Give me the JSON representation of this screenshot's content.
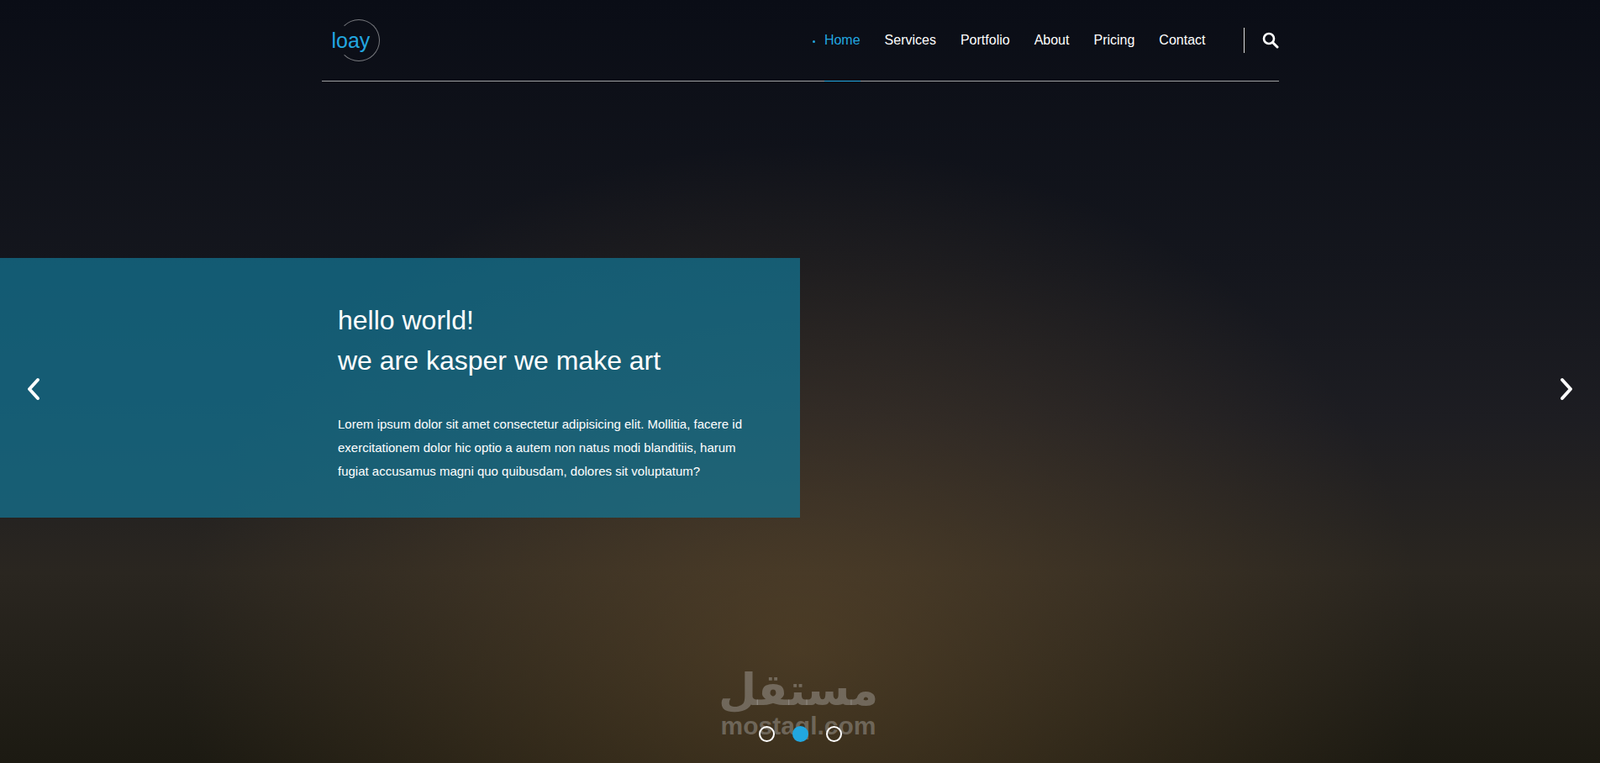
{
  "header": {
    "logo": "loay",
    "nav": [
      {
        "label": "Home",
        "selected": true
      },
      {
        "label": "Services",
        "selected": false
      },
      {
        "label": "Portfolio",
        "selected": false
      },
      {
        "label": "About",
        "selected": false
      },
      {
        "label": "Pricing",
        "selected": false
      },
      {
        "label": "Contact",
        "selected": false
      }
    ]
  },
  "hero": {
    "title_lines": [
      "hello world!",
      "we are kasper we make art"
    ],
    "text": "Lorem ipsum dolor sit amet consectetur adipisicing elit. Mollitia, facere id exercitationem dolor hic optio a autem non natus modi blanditiis, harum fugiat accusamus magni quo quibusdam, dolores sit voluptatum?"
  },
  "slider_dots": [
    {
      "selected": false
    },
    {
      "selected": true
    },
    {
      "selected": false
    }
  ],
  "watermark": {
    "arabic": "مستقل",
    "latin": "mostaql.com"
  }
}
